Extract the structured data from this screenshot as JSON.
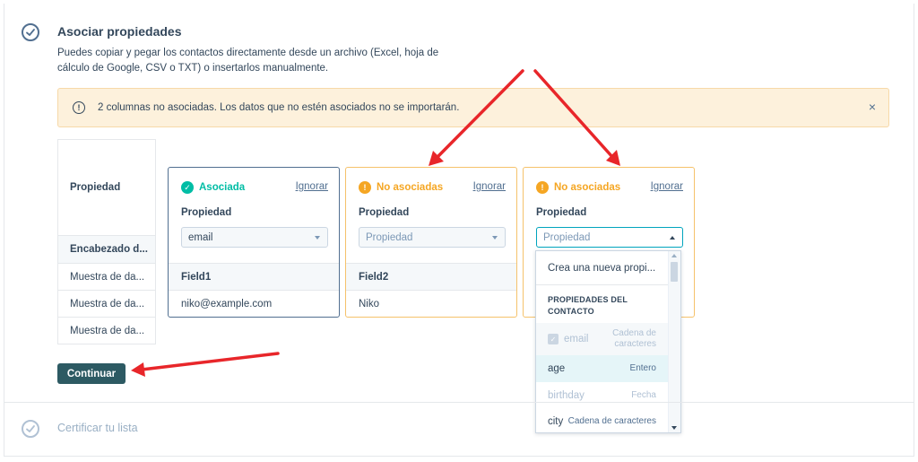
{
  "step": {
    "title": "Asociar propiedades",
    "description": "Puedes copiar y pegar los contactos directamente desde un archivo (Excel, hoja de cálculo de Google, CSV o TXT) o insertarlos manualmente."
  },
  "alert": {
    "text": "2 columnas no asociadas. Los datos que no estén asociados no se importarán.",
    "close": "×"
  },
  "row_labels": [
    "Propiedad",
    "Encabezado d...",
    "Muestra de da...",
    "Muestra de da...",
    "Muestra de da..."
  ],
  "columns": [
    {
      "status": "Asociada",
      "status_type": "mapped",
      "ignore": "Ignorar",
      "property_label": "Propiedad",
      "select_value": "email",
      "header": "Field1",
      "sample": "niko@example.com"
    },
    {
      "status": "No asociadas",
      "status_type": "unmapped",
      "ignore": "Ignorar",
      "property_label": "Propiedad",
      "select_value": "Propiedad",
      "header": "Field2",
      "sample": "Niko"
    },
    {
      "status": "No asociadas",
      "status_type": "unmapped",
      "ignore": "Ignorar",
      "property_label": "Propiedad",
      "select_value": "Propiedad"
    }
  ],
  "dropdown": {
    "create_label": "Crea una nueva propi...",
    "group_label": "PROPIEDADES DEL CONTACTO",
    "options": [
      {
        "name": "email",
        "type": "Cadena de caracteres",
        "state": "disabled"
      },
      {
        "name": "age",
        "type": "Entero",
        "state": "hover"
      },
      {
        "name": "birthday",
        "type": "Fecha",
        "state": "muted"
      },
      {
        "name": "city",
        "type": "Cadena de caracteres",
        "state": "normal"
      }
    ]
  },
  "buttons": {
    "continue": "Continuar"
  },
  "next_step": {
    "title": "Certificar tu lista"
  },
  "colors": {
    "primary_button": "#2d5a63",
    "mapped_green": "#00bda5",
    "unmapped_orange": "#f5a623",
    "alert_bg": "#fdf1dc",
    "annotation_red": "#e8262a"
  }
}
